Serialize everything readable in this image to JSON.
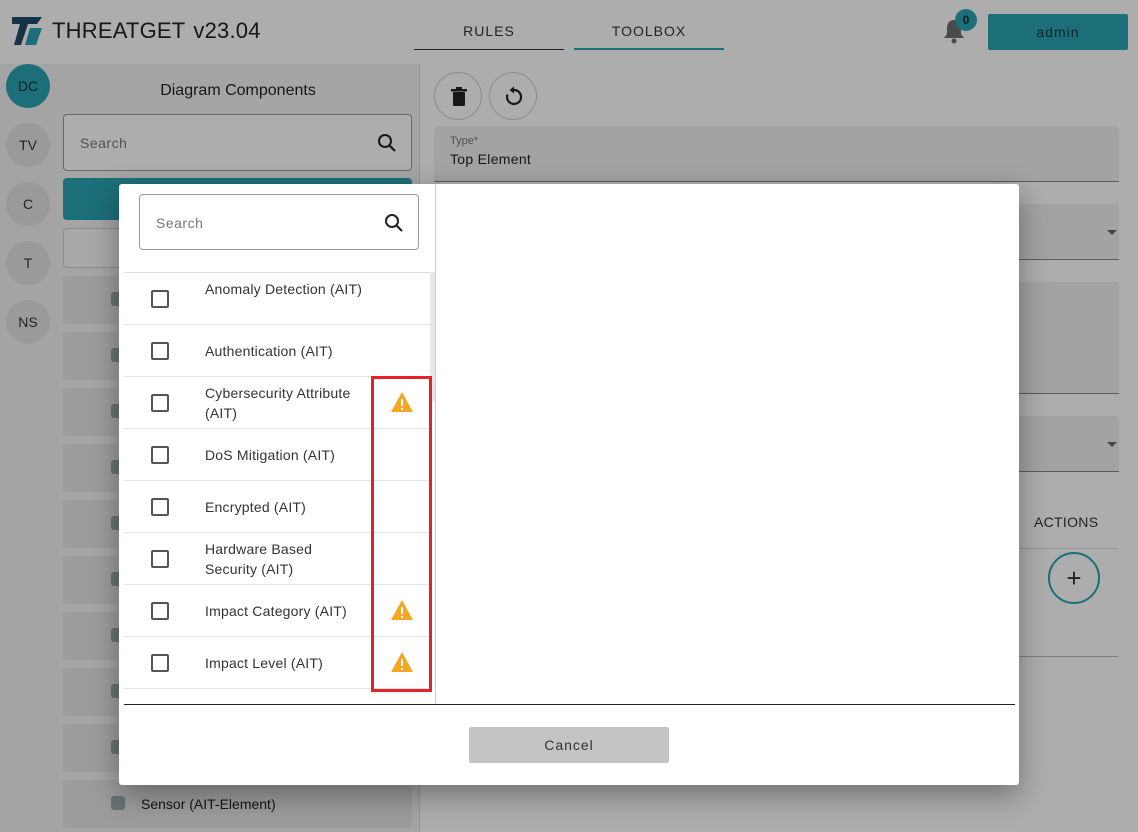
{
  "app": {
    "name": "THREATGET",
    "version": "v23.04"
  },
  "nav": {
    "tabs": [
      {
        "label": "RULES"
      },
      {
        "label": "TOOLBOX"
      }
    ]
  },
  "notifications": {
    "count": "0"
  },
  "user": {
    "label": "admin"
  },
  "rail": {
    "items": [
      {
        "label": "DC"
      },
      {
        "label": "TV"
      },
      {
        "label": "C"
      },
      {
        "label": "T"
      },
      {
        "label": "NS"
      }
    ]
  },
  "components_panel": {
    "title": "Diagram Components",
    "search_placeholder": "Search",
    "visible_item": "Sensor (AIT-Element)"
  },
  "editor": {
    "type_field": {
      "label": "Type*",
      "value": "Top Element"
    },
    "actions_label": "ACTIONS",
    "add_symbol": "+"
  },
  "dialog": {
    "search_placeholder": "Search",
    "items": [
      {
        "label": "Anomaly Detection (AIT)",
        "warning": false
      },
      {
        "label": "Authentication (AIT)",
        "warning": false
      },
      {
        "label": "Cybersecurity Attribute (AIT)",
        "warning": true
      },
      {
        "label": "DoS Mitigation (AIT)",
        "warning": false
      },
      {
        "label": "Encrypted (AIT)",
        "warning": false
      },
      {
        "label": "Hardware Based Security (AIT)",
        "warning": false
      },
      {
        "label": "Impact Category (AIT)",
        "warning": true
      },
      {
        "label": "Impact Level (AIT)",
        "warning": true
      }
    ],
    "cancel_label": "Cancel"
  },
  "colors": {
    "accent": "#2aa4b3",
    "warning": "#f5a623",
    "highlight": "#e8202a"
  },
  "icons": [
    "logo-icon",
    "bell-icon",
    "search-icon",
    "trash-icon",
    "refresh-icon",
    "warning-icon",
    "dropdown-arrow-icon",
    "plus-icon"
  ]
}
